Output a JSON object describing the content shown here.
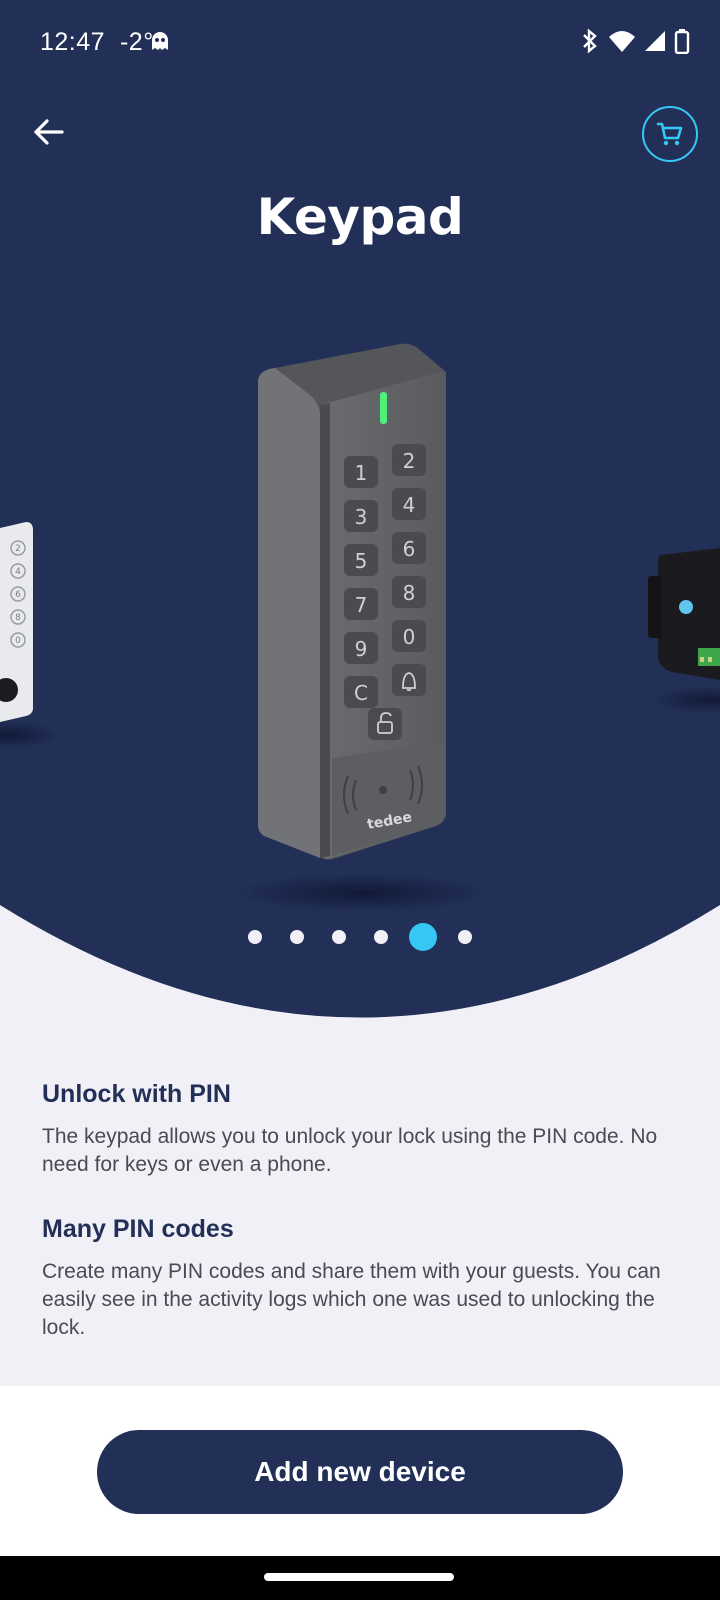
{
  "status_bar": {
    "time": "12:47",
    "temperature": "-2°",
    "icons": [
      "ghost-icon",
      "bluetooth-icon",
      "wifi-icon",
      "signal-icon",
      "battery-icon"
    ]
  },
  "header": {
    "back_icon": "arrow-left-icon",
    "cart_icon": "shopping-cart-icon",
    "title": "Keypad"
  },
  "carousel": {
    "device_brand": "tedee",
    "keypad_keys": [
      "1",
      "2",
      "3",
      "4",
      "5",
      "6",
      "7",
      "8",
      "9",
      "0",
      "C",
      "bell"
    ],
    "page_count": 6,
    "active_index": 4
  },
  "features": [
    {
      "title": "Unlock with PIN",
      "text": "The keypad allows you to unlock your lock using the PIN code. No need for keys or even a phone."
    },
    {
      "title": "Many PIN codes",
      "text": "Create many PIN codes and share them with your guests. You can easily see in the activity logs which one was used to unlocking the lock."
    }
  ],
  "actions": {
    "add_device_label": "Add new device"
  },
  "colors": {
    "hero_bg": "#223058",
    "accent": "#37c7f5",
    "page_bg": "#f2f0f7",
    "button_bg": "#223058"
  }
}
